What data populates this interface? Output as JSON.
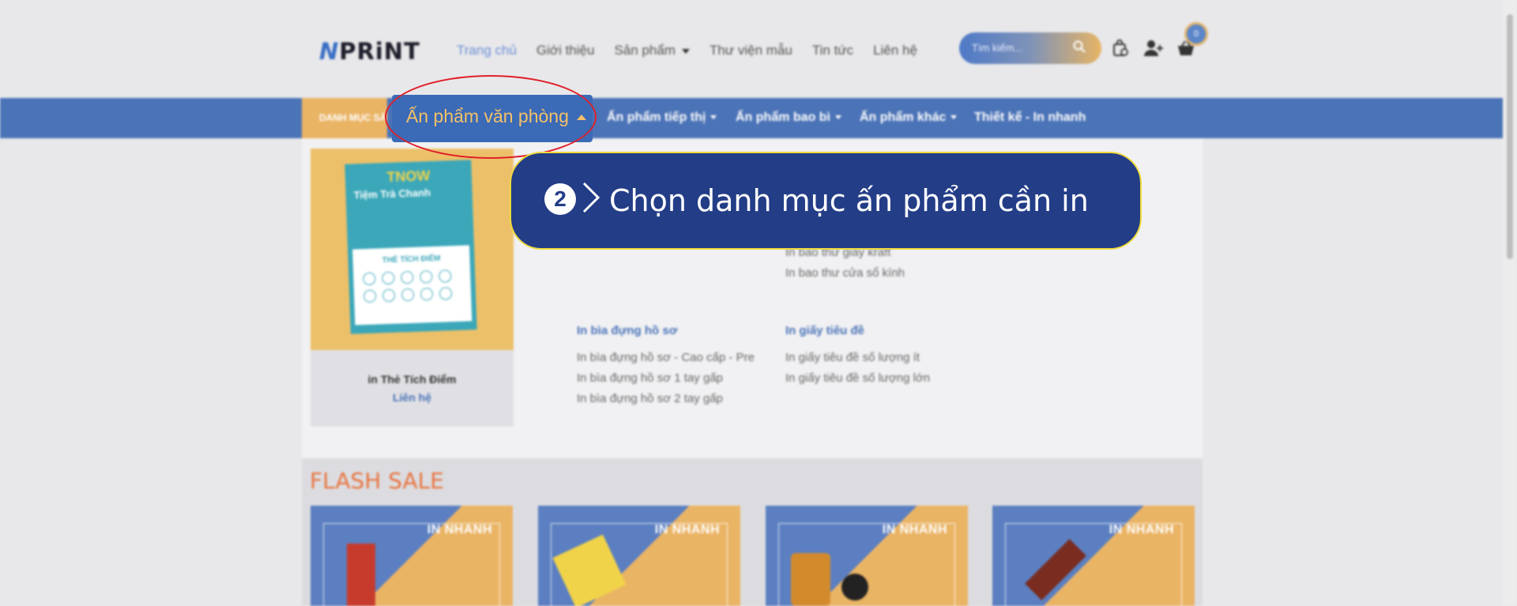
{
  "header": {
    "logo_prefix": "N",
    "logo_suffix": "PRiNT",
    "nav": [
      {
        "label": "Trang chủ"
      },
      {
        "label": "Giới thiệu"
      },
      {
        "label": "Sản phẩm"
      },
      {
        "label": "Thư viện mẫu"
      },
      {
        "label": "Tin tức"
      },
      {
        "label": "Liên hệ"
      }
    ],
    "search_placeholder": "Tìm kiếm...",
    "cart_count": "0"
  },
  "catbar": {
    "danh_muc": "DANH MỤC SẢN PHẨM",
    "items": [
      {
        "label": "Ấn phẩm văn phòng"
      },
      {
        "label": "Ấn phẩm tiếp thị"
      },
      {
        "label": "Ấn phẩm bao bì"
      },
      {
        "label": "Ấn phẩm khác"
      },
      {
        "label": "Thiết kế - In nhanh"
      }
    ]
  },
  "dropdown": {
    "product": {
      "brand": "TNOW",
      "shop": "Tiệm Trà Chanh",
      "card_heading": "THẺ TÍCH ĐIỂM",
      "name": "in Thẻ Tích Điểm",
      "contact": "Liên hệ"
    },
    "col1": {
      "title": "In bìa đựng hồ sơ",
      "items": [
        "In bìa đựng hồ sơ - Cao cấp - Pre",
        "In bìa đựng hồ sơ 1 tay gấp",
        "In bìa đựng hồ sơ 2 tay gấp"
      ]
    },
    "col2_partial": [
      "In bao thư giấy kraft",
      "In bao thư cửa sổ kính"
    ],
    "col2": {
      "title": "In giấy tiêu đề",
      "items": [
        "In giấy tiêu đề số lượng ít",
        "In giấy tiêu đề số lượng lớn"
      ]
    }
  },
  "callout": {
    "number": "2",
    "text": "Chọn danh mục ấn phẩm cần in"
  },
  "flash": {
    "title": "FLASH SALE",
    "cards": [
      {
        "label": "IN NHANH"
      },
      {
        "label": "IN NHANH"
      },
      {
        "label": "IN NHANH"
      },
      {
        "label": "IN NHANH"
      }
    ]
  },
  "colors": {
    "primary": "#4b73b7",
    "accent": "#eab465",
    "callout_bg": "#233d87",
    "callout_border": "#eedb3c",
    "highlight": "#e0202a",
    "flash_title": "#e8743f"
  },
  "icons": [
    "search-icon",
    "order-bag-icon",
    "add-user-icon",
    "basket-icon"
  ]
}
